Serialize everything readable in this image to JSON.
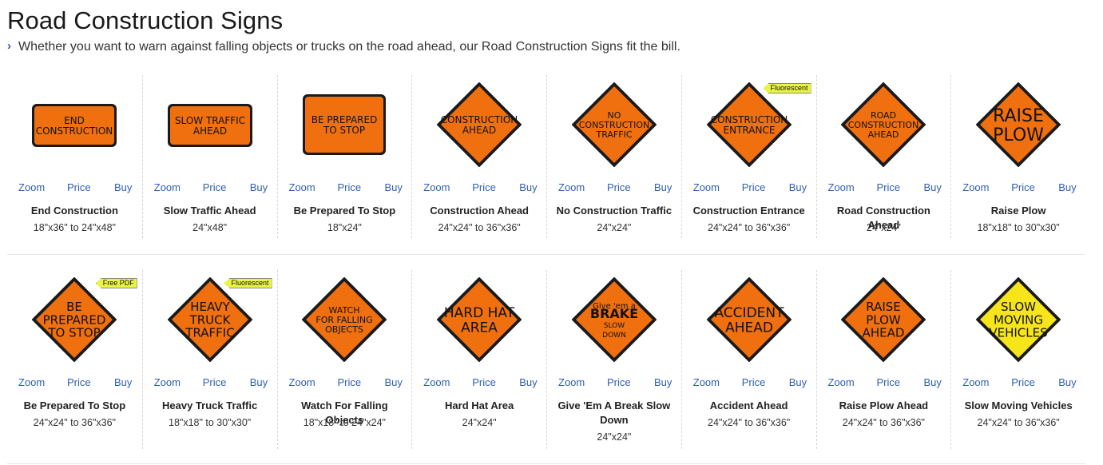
{
  "page": {
    "title": "Road Construction Signs",
    "subtitle": "Whether you want to warn against falling objects or trucks on the road ahead, our Road Construction Signs fit the bill."
  },
  "colors": {
    "sign_orange": "#f07010",
    "sign_yellow": "#f6e51b",
    "link_blue": "#2f5fb3",
    "badge_yellow": "#e9f542"
  },
  "actions": {
    "zoom": "Zoom",
    "price": "Price",
    "buy": "Buy"
  },
  "products": [
    {
      "name": "End Construction",
      "size": "18\"x36\" to 24\"x48\"",
      "shape": "rect-wide",
      "color": "orange",
      "lines": [
        "END",
        "CONSTRUCTION"
      ],
      "badge": ""
    },
    {
      "name": "Slow Traffic Ahead",
      "size": "24\"x48\"",
      "shape": "rect-wide",
      "color": "orange",
      "lines": [
        "SLOW TRAFFIC",
        "AHEAD"
      ],
      "badge": ""
    },
    {
      "name": "Be Prepared To Stop",
      "size": "18\"x24\"",
      "shape": "rect-tall",
      "color": "orange",
      "lines": [
        "BE PREPARED",
        "TO STOP"
      ],
      "badge": ""
    },
    {
      "name": "Construction Ahead",
      "size": "24\"x24\" to 36\"x36\"",
      "shape": "diamond",
      "color": "orange",
      "lines": [
        "CONSTRUCTION",
        "AHEAD"
      ],
      "badge": ""
    },
    {
      "name": "No Construction Traffic",
      "size": "24\"x24\"",
      "shape": "diamond",
      "color": "orange",
      "lines": [
        "NO",
        "CONSTRUCTION",
        "TRAFFIC"
      ],
      "badge": ""
    },
    {
      "name": "Construction Entrance",
      "size": "24\"x24\" to 36\"x36\"",
      "shape": "diamond",
      "color": "orange",
      "lines": [
        "CONSTRUCTION",
        "ENTRANCE"
      ],
      "badge": "Fluorescent"
    },
    {
      "name": "Road Construction Ahead",
      "size": "24\"x24\"",
      "shape": "diamond",
      "color": "orange",
      "lines": [
        "ROAD",
        "CONSTRUCTION",
        "AHEAD"
      ],
      "badge": ""
    },
    {
      "name": "Raise Plow",
      "size": "18\"x18\" to 30\"x30\"",
      "shape": "diamond",
      "color": "orange",
      "lines": [
        "RAISE",
        "PLOW"
      ],
      "badge": ""
    },
    {
      "name": "Be Prepared To Stop",
      "size": "24\"x24\" to 36\"x36\"",
      "shape": "diamond",
      "color": "orange",
      "lines": [
        "BE",
        "PREPARED",
        "TO STOP"
      ],
      "badge": "Free PDF"
    },
    {
      "name": "Heavy Truck Traffic",
      "size": "18\"x18\" to 30\"x30\"",
      "shape": "diamond",
      "color": "orange",
      "lines": [
        "HEAVY",
        "TRUCK",
        "TRAFFIC"
      ],
      "badge": "Fluorescent"
    },
    {
      "name": "Watch For Falling Objects",
      "size": "18\"x18\" to 24\"x24\"",
      "shape": "diamond",
      "color": "orange",
      "lines": [
        "WATCH",
        "FOR FALLING",
        "OBJECTS"
      ],
      "badge": ""
    },
    {
      "name": "Hard Hat Area",
      "size": "24\"x24\"",
      "shape": "diamond",
      "color": "orange",
      "lines": [
        "HARD HAT",
        "AREA"
      ],
      "badge": ""
    },
    {
      "name": "Give 'Em A Break Slow Down",
      "size": "24\"x24\"",
      "shape": "diamond",
      "color": "orange",
      "lines": [
        "Give 'em a",
        "BRAKE",
        "SLOW",
        "DOWN"
      ],
      "badge": ""
    },
    {
      "name": "Accident Ahead",
      "size": "24\"x24\" to 36\"x36\"",
      "shape": "diamond",
      "color": "orange",
      "lines": [
        "ACCIDENT",
        "AHEAD"
      ],
      "badge": ""
    },
    {
      "name": "Raise Plow Ahead",
      "size": "24\"x24\" to 36\"x36\"",
      "shape": "diamond",
      "color": "orange",
      "lines": [
        "RAISE",
        "PLOW",
        "AHEAD"
      ],
      "badge": ""
    },
    {
      "name": "Slow Moving Vehicles",
      "size": "24\"x24\" to 36\"x36\"",
      "shape": "diamond",
      "color": "yellow",
      "lines": [
        "SLOW",
        "MOVING",
        "VEHICLES"
      ],
      "badge": ""
    }
  ]
}
